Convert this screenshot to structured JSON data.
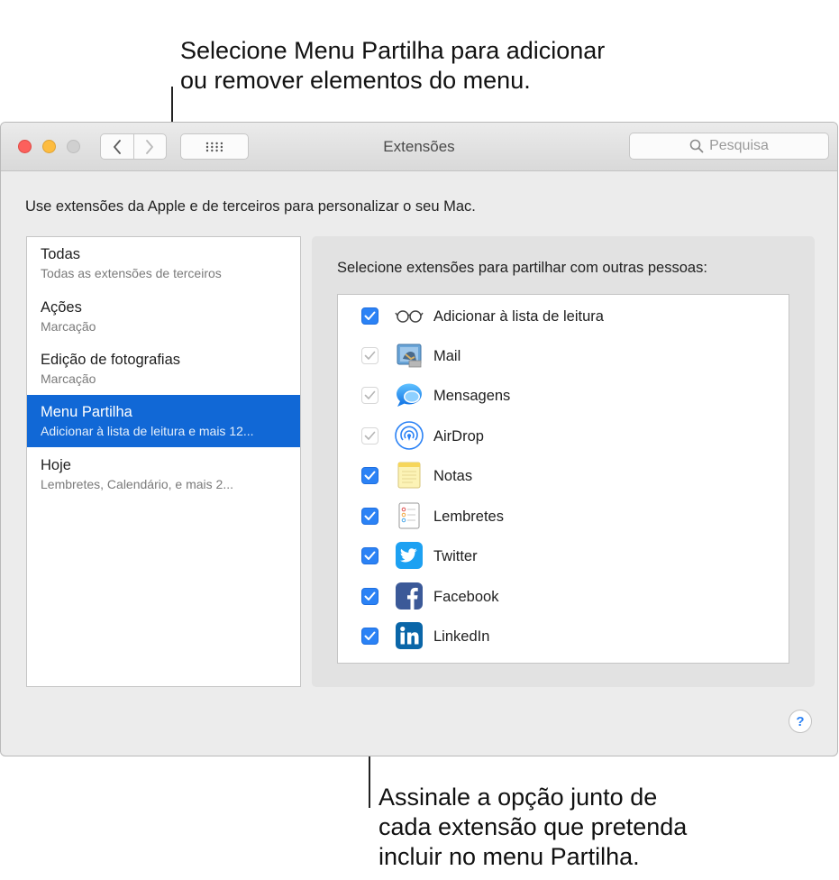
{
  "callouts": {
    "top_line1": "Selecione Menu Partilha para adicionar",
    "top_line2": "ou remover elementos do menu.",
    "bottom_line1": "Assinale a opção junto de",
    "bottom_line2": "cada extensão que pretenda",
    "bottom_line3": "incluir no menu Partilha."
  },
  "window": {
    "title": "Extensões",
    "search_placeholder": "Pesquisa",
    "description": "Use extensões da Apple e de terceiros para personalizar o seu Mac.",
    "help_label": "?"
  },
  "sidebar": {
    "items": [
      {
        "name": "Todas",
        "sub": "Todas as extensões de terceiros",
        "selected": false
      },
      {
        "name": "Ações",
        "sub": "Marcação",
        "selected": false
      },
      {
        "name": "Edição de fotografias",
        "sub": "Marcação",
        "selected": false
      },
      {
        "name": "Menu Partilha",
        "sub": "Adicionar à lista de leitura e mais 12...",
        "selected": true
      },
      {
        "name": "Hoje",
        "sub": "Lembretes, Calendário, e mais 2...",
        "selected": false
      }
    ]
  },
  "panel": {
    "label": "Selecione extensões para partilhar com outras pessoas:",
    "extensions": [
      {
        "label": "Adicionar à lista de leitura",
        "checked": true,
        "locked": false,
        "icon": "reading-glasses-icon"
      },
      {
        "label": "Mail",
        "checked": true,
        "locked": true,
        "icon": "mail-app-icon"
      },
      {
        "label": "Mensagens",
        "checked": true,
        "locked": true,
        "icon": "messages-app-icon"
      },
      {
        "label": "AirDrop",
        "checked": true,
        "locked": true,
        "icon": "airdrop-icon"
      },
      {
        "label": "Notas",
        "checked": true,
        "locked": false,
        "icon": "notes-app-icon"
      },
      {
        "label": "Lembretes",
        "checked": true,
        "locked": false,
        "icon": "reminders-app-icon"
      },
      {
        "label": "Twitter",
        "checked": true,
        "locked": false,
        "icon": "twitter-icon"
      },
      {
        "label": "Facebook",
        "checked": true,
        "locked": false,
        "icon": "facebook-icon"
      },
      {
        "label": "LinkedIn",
        "checked": true,
        "locked": false,
        "icon": "linkedin-icon"
      }
    ]
  },
  "colors": {
    "selection": "#1168d6",
    "checkbox": "#2b82f5"
  }
}
